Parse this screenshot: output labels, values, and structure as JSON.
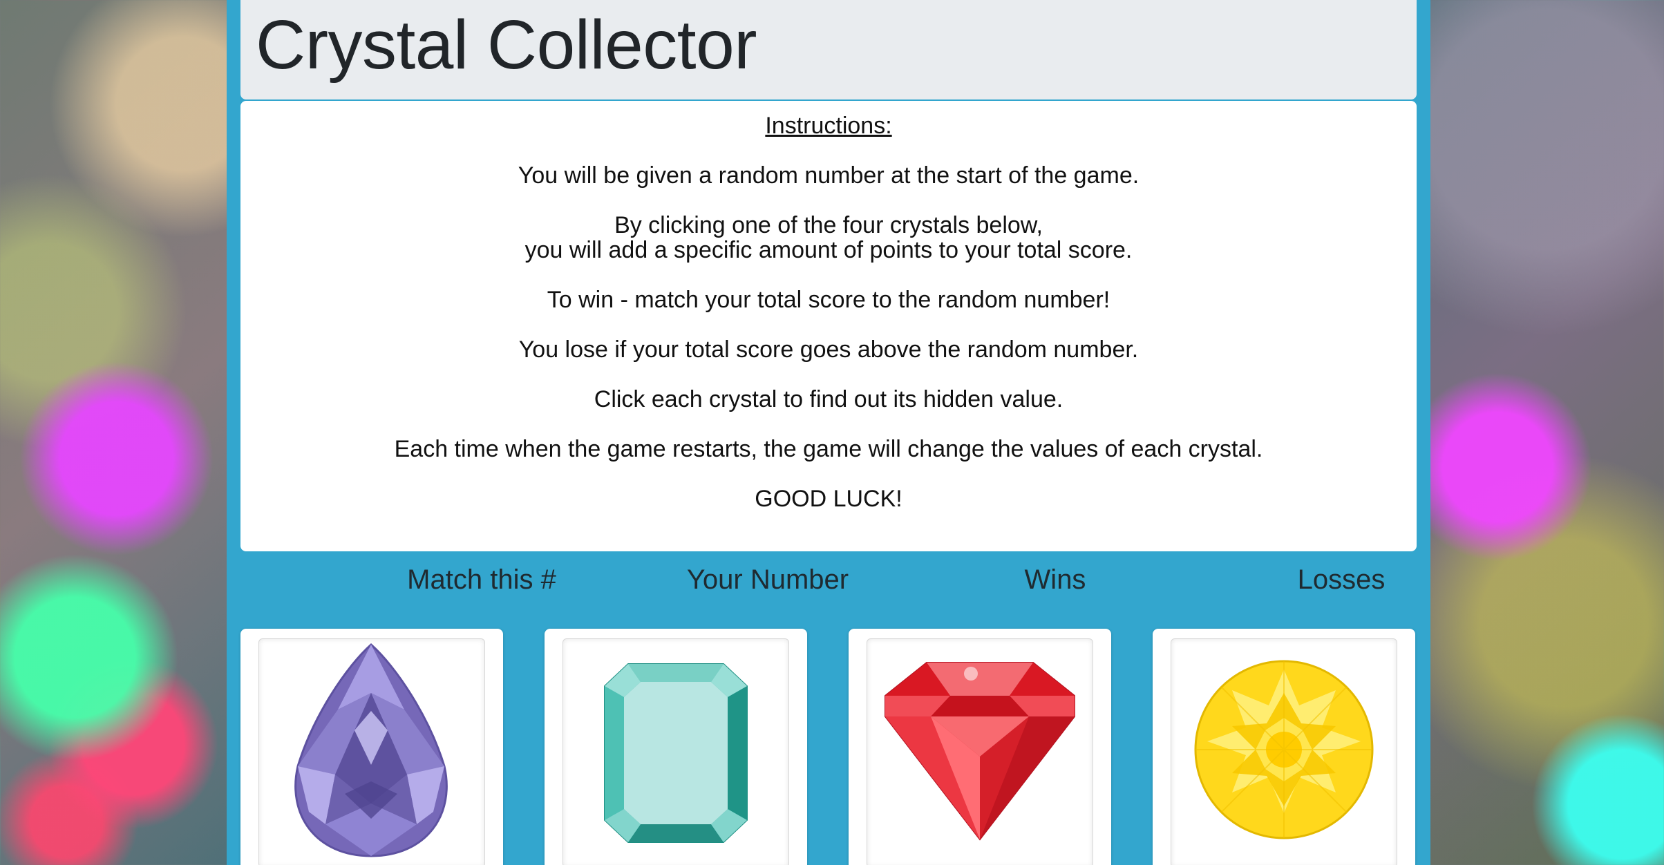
{
  "header": {
    "title": "Crystal Collector"
  },
  "instructions": {
    "heading": "Instructions:",
    "lines": [
      "You will be given a random number at the start of the game.",
      "By clicking one of the four crystals below,",
      "you will add a specific amount of points to your total score.",
      "To win - match your total score to the random number!",
      "You lose if your total score goes above the random number.",
      "Click each crystal to find out its hidden value.",
      "Each time when the game restarts, the game will change the values of each crystal.",
      "GOOD LUCK!"
    ]
  },
  "stats": {
    "match_label": "Match this #",
    "your_number_label": "Your Number",
    "wins_label": "Wins",
    "losses_label": "Losses"
  },
  "crystals": [
    {
      "icon": "purple-teardrop-crystal-icon",
      "color": "#7668b8"
    },
    {
      "icon": "teal-emerald-crystal-icon",
      "color": "#2bab9f"
    },
    {
      "icon": "red-gem-crystal-icon",
      "color": "#e4232f"
    },
    {
      "icon": "yellow-round-crystal-icon",
      "color": "#ffd81c"
    }
  ]
}
